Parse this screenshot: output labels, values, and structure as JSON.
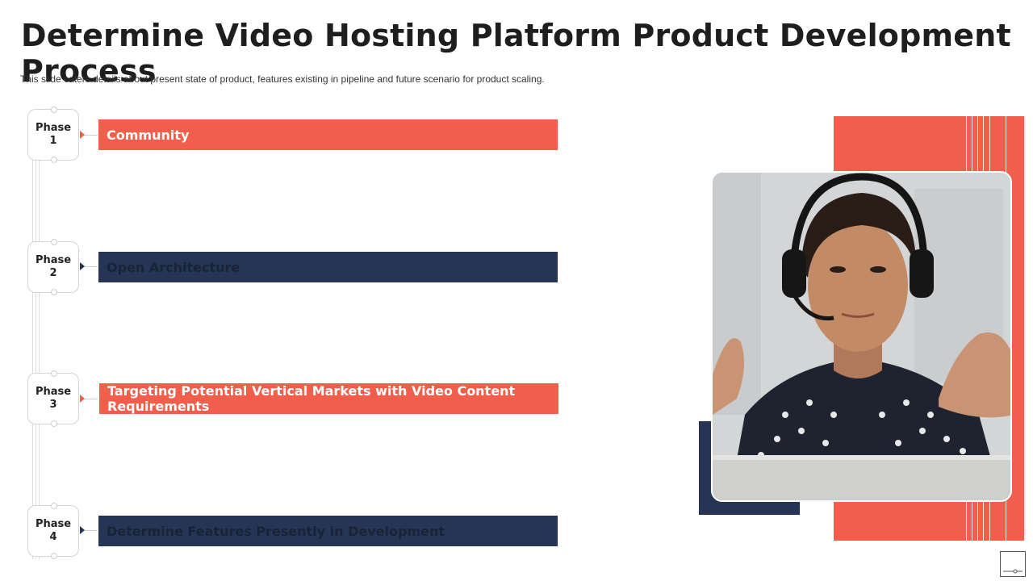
{
  "slide": {
    "title": "Determine Video Hosting Platform Product Development Process",
    "subtitle": "This slide caters details about present state of  product, features  existing in pipeline  and future  scenario for product scaling."
  },
  "phases": [
    {
      "label_line1": "Phase",
      "label_line2": "1",
      "text": "Community",
      "color": "#f15f4c"
    },
    {
      "label_line1": "Phase",
      "label_line2": "2",
      "text": "Open Architecture",
      "color": "#263556"
    },
    {
      "label_line1": "Phase",
      "label_line2": "3",
      "text": "Targeting Potential  Vertical Markets with Video Content Requirements",
      "color": "#f15f4c"
    },
    {
      "label_line1": "Phase",
      "label_line2": "4",
      "text": "Determine Features Presently  in Development",
      "color": "#263556"
    }
  ],
  "image": {
    "icon": "woman-with-headset-photo"
  },
  "colors": {
    "accent": "#f15f4c",
    "navy": "#263556"
  }
}
